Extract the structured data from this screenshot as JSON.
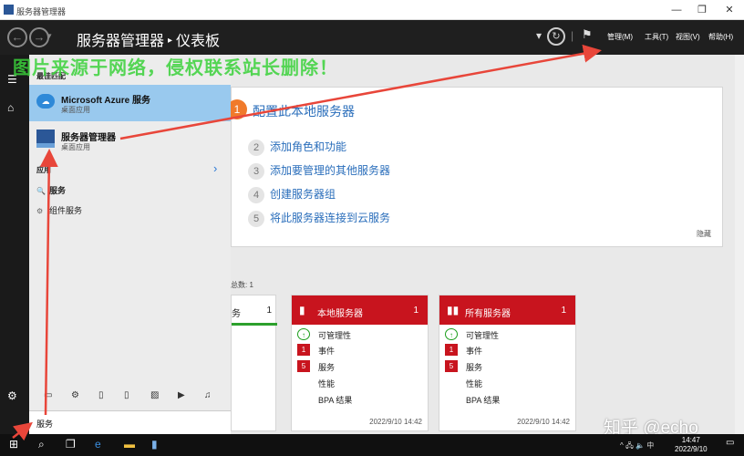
{
  "window": {
    "title": "服务器管理器",
    "minimize": "—",
    "maximize": "❐",
    "close": "✕"
  },
  "header": {
    "back": "←",
    "forward": "→",
    "dropdown": "▾",
    "breadcrumb_app": "服务器管理器",
    "breadcrumb_sep": "▸",
    "breadcrumb_page": "仪表板",
    "refresh": "↻",
    "flag": "⚑",
    "menus": [
      "管理(M)",
      "工具(T)",
      "视图(V)",
      "帮助(H)"
    ]
  },
  "watermark": "图片来源于网络，侵权联系站长删除！",
  "start_menu": {
    "best_match_label": "最佳匹配",
    "results": [
      {
        "name": "Microsoft Azure 服务",
        "sub": "桌面应用"
      },
      {
        "name": "服务器管理器",
        "sub": "桌面应用"
      }
    ],
    "apps_label": "应用",
    "apps": [
      "服务",
      "组件服务"
    ],
    "search_query": "服务"
  },
  "welcome": {
    "step1_num": "1",
    "step1": "配置此本地服务器",
    "steps": [
      {
        "n": "2",
        "label": "添加角色和功能"
      },
      {
        "n": "3",
        "label": "添加要管理的其他服务器"
      },
      {
        "n": "4",
        "label": "创建服务器组"
      },
      {
        "n": "5",
        "label": "将此服务器连接到云服务"
      }
    ],
    "hide": "隐藏"
  },
  "roles": {
    "caption": "总数: 1",
    "partial_title": "务",
    "partial_count": "1"
  },
  "tiles": [
    {
      "title": "本地服务器",
      "count": "1",
      "rows": [
        {
          "mark": "↑",
          "type": "ok",
          "label": "可管理性"
        },
        {
          "mark": "1",
          "type": "bad",
          "label": "事件"
        },
        {
          "mark": "5",
          "type": "bad",
          "label": "服务"
        },
        {
          "mark": "",
          "type": "",
          "label": "性能"
        },
        {
          "mark": "",
          "type": "",
          "label": "BPA 结果"
        }
      ],
      "timestamp": "2022/9/10 14:42"
    },
    {
      "title": "所有服务器",
      "count": "1",
      "rows": [
        {
          "mark": "↑",
          "type": "ok",
          "label": "可管理性"
        },
        {
          "mark": "1",
          "type": "bad",
          "label": "事件"
        },
        {
          "mark": "5",
          "type": "bad",
          "label": "服务"
        },
        {
          "mark": "",
          "type": "",
          "label": "性能"
        },
        {
          "mark": "",
          "type": "",
          "label": "BPA 结果"
        }
      ],
      "timestamp": "2022/9/10 14:42"
    }
  ],
  "taskbar": {
    "tray": "^ 🖧 🔈 中",
    "time": "14:47",
    "date": "2022/9/10"
  },
  "zhihu_mark": "知乎 @echo",
  "colors": {
    "accent_red": "#c8141e",
    "highlight_blue": "#99c9ee",
    "annotation_red": "#e8463a"
  }
}
